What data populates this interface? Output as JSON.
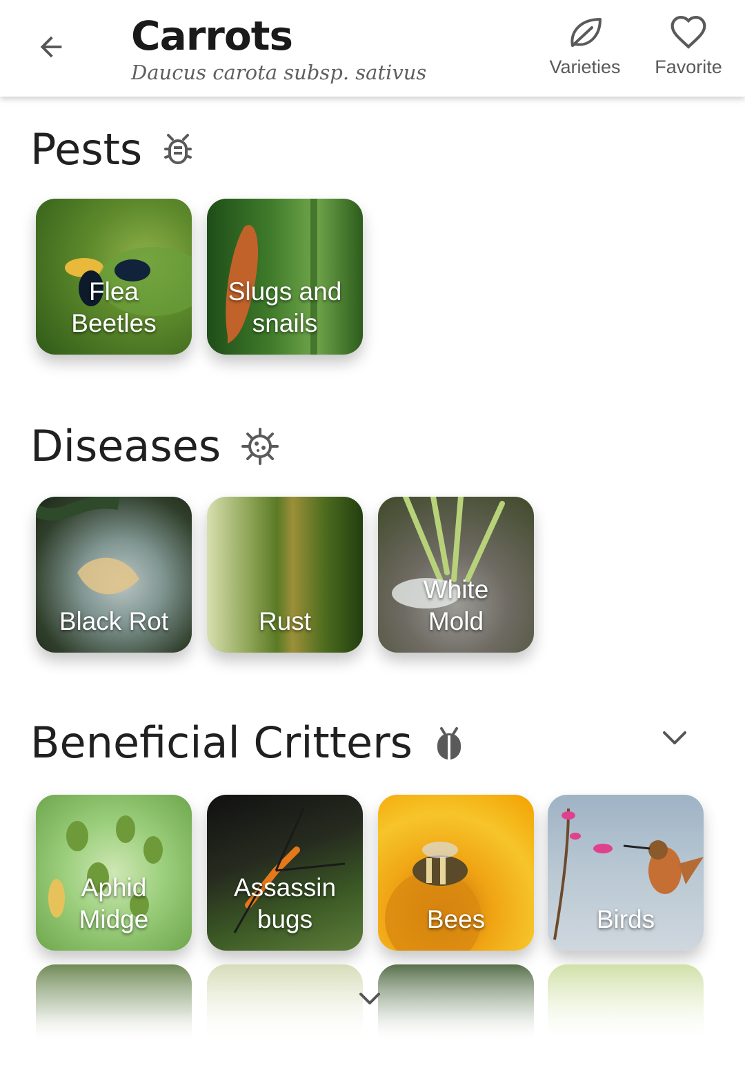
{
  "header": {
    "title": "Carrots",
    "subtitle": "Daucus carota subsp. sativus",
    "actions": [
      {
        "label": "Varieties",
        "icon": "leaf-icon"
      },
      {
        "label": "Favorite",
        "icon": "heart-icon"
      }
    ]
  },
  "sections": {
    "pests": {
      "title": "Pests",
      "icon": "bug-icon",
      "items": [
        "Flea\nBeetles",
        "Slugs and\nsnails"
      ]
    },
    "diseases": {
      "title": "Diseases",
      "icon": "virus-icon",
      "items": [
        "Black Rot",
        "Rust",
        "White\nMold"
      ]
    },
    "beneficial": {
      "title": "Beneficial Critters",
      "icon": "ladybug-icon",
      "items": [
        "Aphid\nMidge",
        "Assassin\nbugs",
        "Bees",
        "Birds"
      ]
    }
  },
  "colors": {
    "text": "#1f1f1f",
    "subtext": "#5f5f5f",
    "icon": "#5a5a5a"
  }
}
